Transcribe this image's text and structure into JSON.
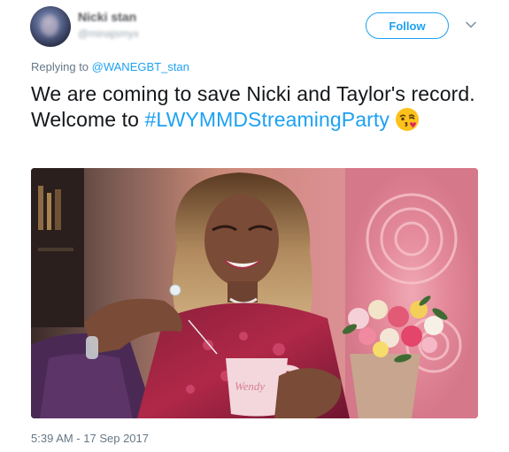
{
  "user": {
    "display_name": "Nicki stan",
    "handle": "@minajsmyx"
  },
  "actions": {
    "follow_label": "Follow"
  },
  "reply": {
    "prefix": "Replying to ",
    "mention": "@WANEGBT_stan"
  },
  "tweet": {
    "text_line": "We are coming to save Nicki and Taylor's record. Welcome to ",
    "hashtag": "#LWYMMDStreamingParty",
    "emoji": "face-blowing-kiss-emoji"
  },
  "photo": {
    "mug_text": "Wendy"
  },
  "timestamp": "5:39 AM - 17 Sep 2017",
  "colors": {
    "accent": "#1da1f2",
    "text": "#14171a",
    "muted": "#657786"
  }
}
